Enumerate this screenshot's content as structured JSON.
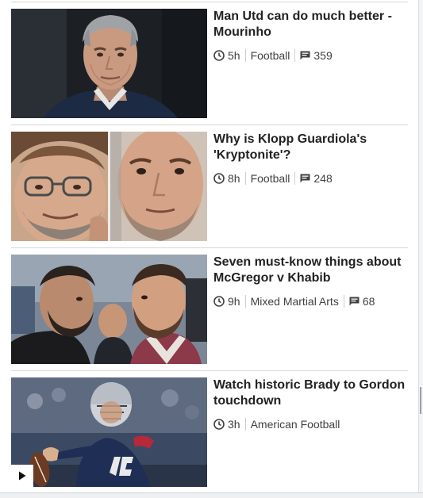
{
  "stories": [
    {
      "headline": "Man Utd can do much better - Mourinho",
      "time": "5h",
      "topic": "Football",
      "comments": "359",
      "image": "mourinho-portrait"
    },
    {
      "headline": "Why is Klopp Guardiola's 'Kryptonite'?",
      "time": "8h",
      "topic": "Football",
      "comments": "248",
      "image": "klopp-guardiola-split"
    },
    {
      "headline": "Seven must-know things about McGregor v Khabib",
      "time": "9h",
      "topic": "Mixed Martial Arts",
      "comments": "68",
      "image": "mcgregor-khabib-faceoff"
    },
    {
      "headline": "Watch historic Brady to Gordon touchdown",
      "time": "3h",
      "topic": "American Football",
      "image": "brady-throwing",
      "video": true
    }
  ],
  "icons": {
    "time": "clock-icon",
    "comments": "comment-icon",
    "video": "play-icon"
  },
  "colors": {
    "headline": "#222222",
    "meta": "#404040",
    "divider": "#d7d7d7",
    "background": "#ffffff"
  }
}
